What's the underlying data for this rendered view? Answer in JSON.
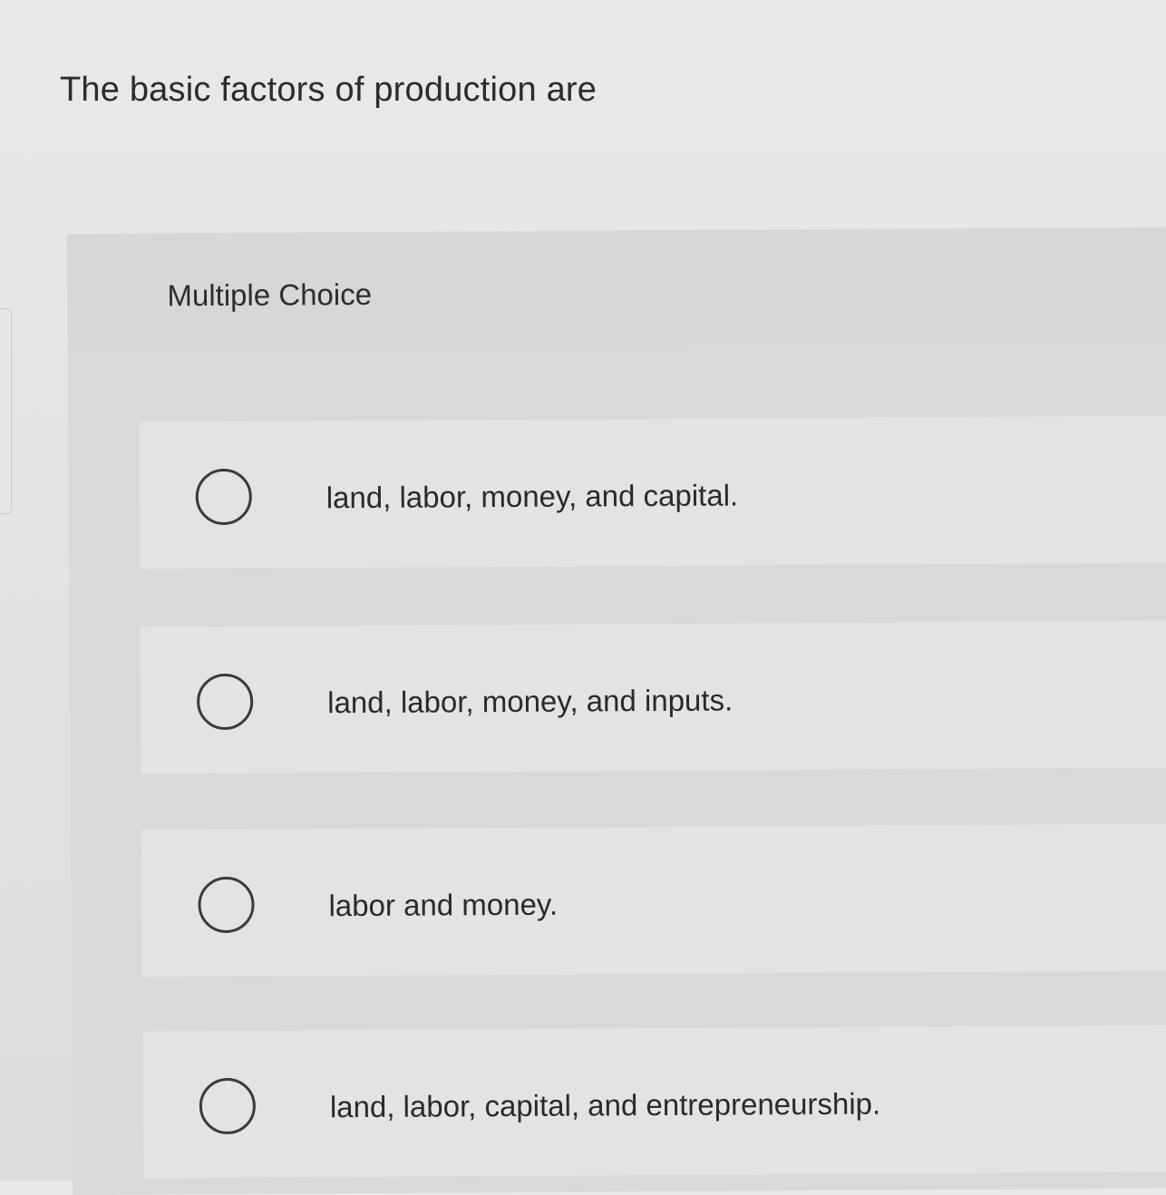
{
  "question": {
    "text": "The basic factors of production are"
  },
  "multiple_choice": {
    "label": "Multiple Choice",
    "options": [
      {
        "text": "land, labor, money, and capital.",
        "selected": false
      },
      {
        "text": "land, labor, money, and inputs.",
        "selected": false
      },
      {
        "text": "labor and money.",
        "selected": false
      },
      {
        "text": "land, labor, capital, and entrepreneurship.",
        "selected": false
      }
    ]
  }
}
